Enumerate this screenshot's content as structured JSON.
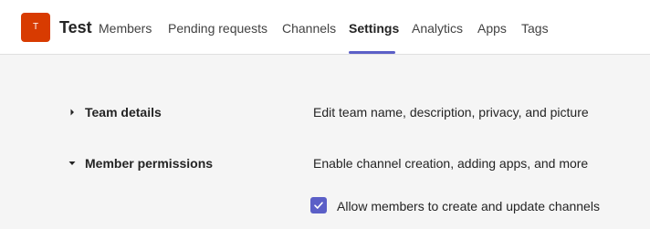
{
  "header": {
    "avatar_initial": "T",
    "team_name": "Test",
    "tabs": [
      {
        "label": "Members",
        "active": false
      },
      {
        "label": "Pending requests",
        "active": false
      },
      {
        "label": "Channels",
        "active": false
      },
      {
        "label": "Settings",
        "active": true
      },
      {
        "label": "Analytics",
        "active": false
      },
      {
        "label": "Apps",
        "active": false
      },
      {
        "label": "Tags",
        "active": false
      }
    ]
  },
  "settings": {
    "sections": [
      {
        "title": "Team details",
        "description": "Edit team name, description, privacy, and picture",
        "expanded": false
      },
      {
        "title": "Member permissions",
        "description": "Enable channel creation, adding apps, and more",
        "expanded": true
      }
    ],
    "member_permissions": {
      "allow_create_update_channels": {
        "label": "Allow members to create and update channels",
        "checked": true
      }
    }
  },
  "colors": {
    "accent": "#5b5fc7",
    "avatar_bg": "#d83b01",
    "page_bg": "#f5f5f5",
    "header_bg": "#ffffff"
  },
  "icons": {
    "collapsed": "chevron-right-icon",
    "expanded": "chevron-down-icon",
    "checked": "checkmark-icon"
  }
}
